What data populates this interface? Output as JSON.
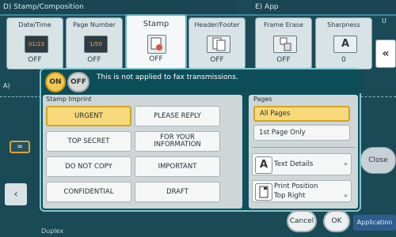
{
  "header": {
    "left_section": "D) Stamp/Composition",
    "right_section": "E) App",
    "unit_label": "U"
  },
  "tabs": [
    {
      "label": "Date/Time",
      "value": "OFF",
      "icon": "date-time-icon",
      "icon_text": "01/23"
    },
    {
      "label": "Page Number",
      "value": "OFF",
      "icon": "page-number-icon",
      "icon_text": "1/50"
    },
    {
      "label": "Stamp",
      "value": "OFF",
      "icon": "stamp-icon"
    },
    {
      "label": "Header/Footer",
      "value": "OFF",
      "icon": "header-footer-icon"
    },
    {
      "label": "Frame Erase",
      "value": "OFF",
      "icon": "frame-erase-icon"
    },
    {
      "label": "Sharpness",
      "value": "0",
      "icon": "sharpness-icon"
    }
  ],
  "background": {
    "section_a": "A)",
    "close_label": "Close",
    "duplex_label": "Duplex",
    "application_label": "Application"
  },
  "dialog": {
    "on_label": "ON",
    "off_label": "OFF",
    "info_text": "This is not applied to fax transmissions.",
    "stamp_imprint": {
      "title": "Stamp Imprint",
      "buttons": [
        {
          "label": "URGENT",
          "selected": true
        },
        {
          "label": "PLEASE REPLY",
          "selected": false
        },
        {
          "label": "TOP SECRET",
          "selected": false
        },
        {
          "label": "FOR YOUR INFORMATION",
          "selected": false
        },
        {
          "label": "DO NOT COPY",
          "selected": false
        },
        {
          "label": "IMPORTANT",
          "selected": false
        },
        {
          "label": "CONFIDENTIAL",
          "selected": false
        },
        {
          "label": "DRAFT",
          "selected": false
        }
      ]
    },
    "pages": {
      "title": "Pages",
      "options": [
        {
          "label": "All Pages",
          "selected": true
        },
        {
          "label": "1st Page Only",
          "selected": false
        }
      ]
    },
    "text_details": {
      "label": "Text Details",
      "icon": "letter-a-icon"
    },
    "print_position": {
      "label": "Print Position",
      "value": "Top Right",
      "icon": "print-position-icon"
    },
    "cancel_label": "Cancel",
    "ok_label": "OK"
  },
  "colors": {
    "selected": "#f7d97c",
    "dialog_bg": "#0e4f59",
    "panel_bg": "#cfd6d8"
  }
}
